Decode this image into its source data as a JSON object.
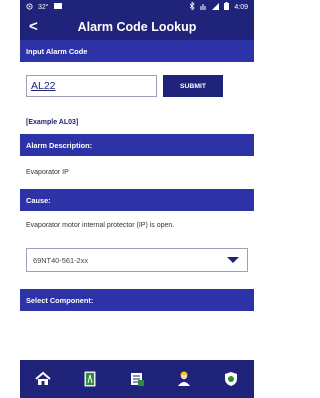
{
  "status_bar": {
    "temperature": "32°",
    "time": "4:09",
    "icons": [
      "wifi-icon",
      "image-icon",
      "bluetooth-icon",
      "signal-icon",
      "battery-icon"
    ]
  },
  "app_bar": {
    "back_symbol": "<",
    "title": "Alarm Code Lookup"
  },
  "input_section": {
    "label": "Input Alarm Code",
    "value": "AL22",
    "submit_label": "SUBMIT",
    "example": "[Example AL03]"
  },
  "description_section": {
    "label": "Alarm Description:",
    "value": "Evaporator IP"
  },
  "cause_section": {
    "label": "Cause:",
    "value": "Evaporator motor internal protector (IP) is open.",
    "model_selected": "69NT40-561-2xx"
  },
  "component_section": {
    "label": "Select Component:"
  },
  "bottom_nav": {
    "items": [
      "home-icon",
      "manual-icon",
      "checklist-icon",
      "technician-icon",
      "shield-icon"
    ]
  },
  "colors": {
    "primary": "#20237a",
    "section": "#2d33a6",
    "background": "#ffffff"
  }
}
